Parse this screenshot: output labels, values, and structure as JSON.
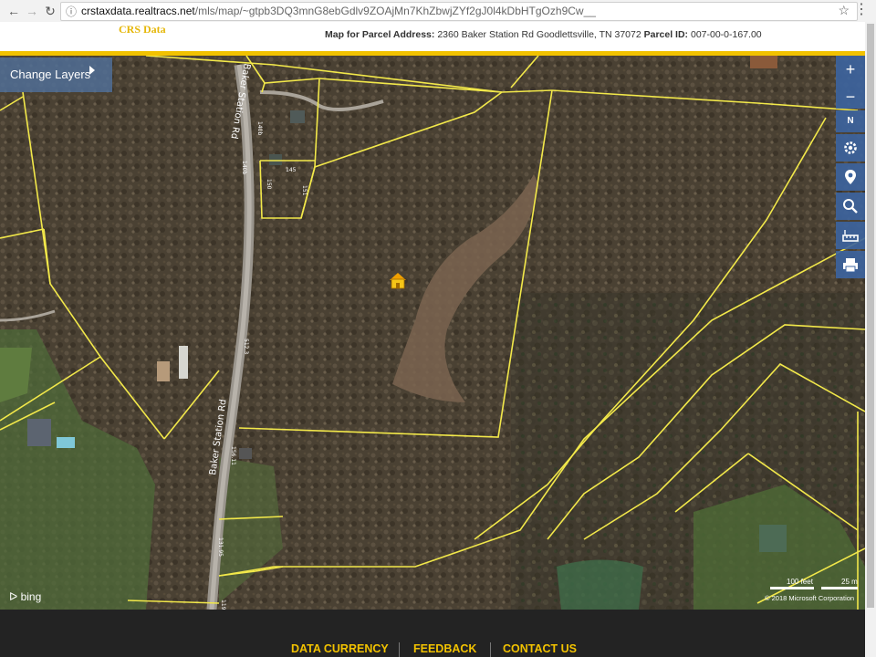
{
  "browser": {
    "url_host": "crstaxdata.realtracs.net",
    "url_path": "/mls/map/~gtpb3DQ3mnG8ebGdlv9ZOAjMn7KhZbwjZYf2gJ0l4kDbHTgOzh9Cw__"
  },
  "header": {
    "brand": "CRS Data",
    "address_label": "Map for Parcel Address:",
    "address_value": "2360 Baker Station Rd Goodlettsville, TN 37072",
    "parcel_label": "Parcel ID:",
    "parcel_value": "007-00-0-167.00"
  },
  "map": {
    "change_layers_label": "Change Layers",
    "compass_label": "N",
    "road_name_1": "Baker Station Rd",
    "road_name_2": "Baker Station Rd",
    "bing_label": "bing",
    "scale_feet": "100 feet",
    "scale_meters": "25 m",
    "copyright": "© 2018 Microsoft Corporation",
    "parcel_labels": [
      "140b",
      "140b",
      "145",
      "150",
      "151",
      "512.3",
      "156.11",
      "131.95",
      "119"
    ],
    "colors": {
      "parcel_line": "#f2e84a",
      "accent": "#f2c200",
      "toolbar": "#3c64a0"
    }
  },
  "toolbar": {
    "zoom_in": "+",
    "zoom_out": "−"
  },
  "footer": {
    "links": [
      "DATA CURRENCY",
      "FEEDBACK",
      "CONTACT US"
    ]
  }
}
